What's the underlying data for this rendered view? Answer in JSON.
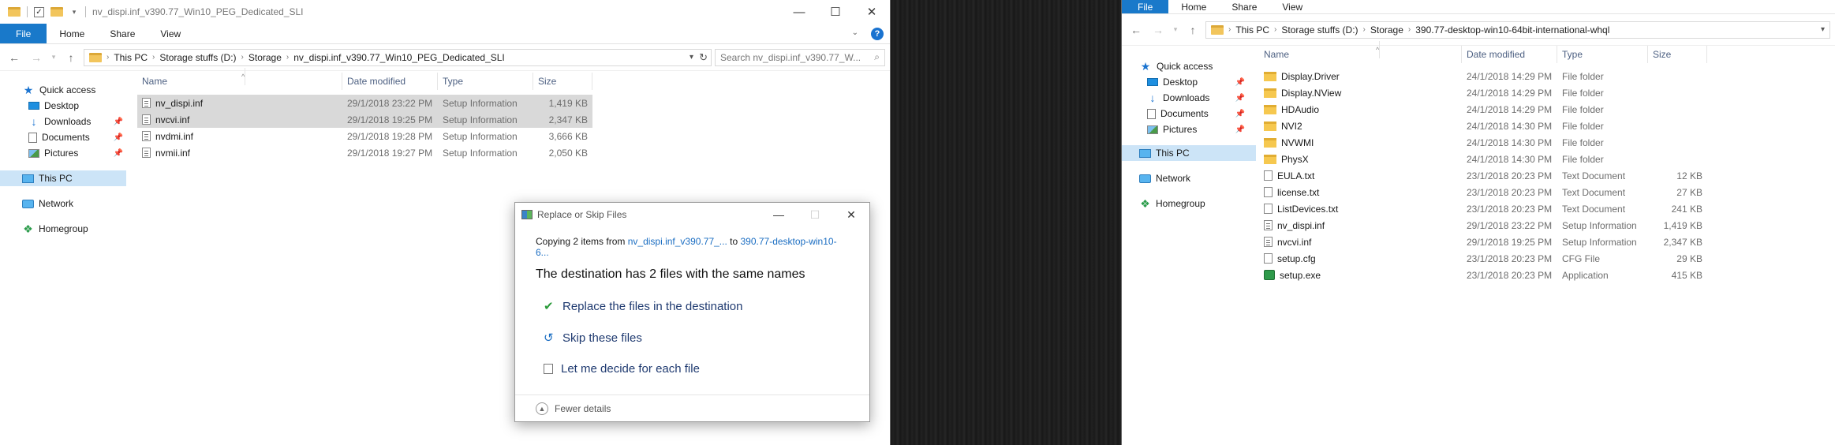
{
  "left_window": {
    "title": "nv_dispi.inf_v390.77_Win10_PEG_Dedicated_SLI",
    "ribbon_tabs": [
      "File",
      "Home",
      "Share",
      "View"
    ],
    "breadcrumbs": [
      "This PC",
      "Storage stuffs (D:)",
      "Storage",
      "nv_dispi.inf_v390.77_Win10_PEG_Dedicated_SLI"
    ],
    "search_placeholder": "Search nv_dispi.inf_v390.77_W...",
    "nav": {
      "quick_access": "Quick access",
      "items": [
        "Desktop",
        "Downloads",
        "Documents",
        "Pictures"
      ],
      "this_pc": "This PC",
      "network": "Network",
      "homegroup": "Homegroup"
    },
    "columns": [
      "Name",
      "Date modified",
      "Type",
      "Size"
    ],
    "files": [
      {
        "name": "nv_dispi.inf",
        "date": "29/1/2018 23:22 PM",
        "type": "Setup Information",
        "size": "1,419 KB"
      },
      {
        "name": "nvcvi.inf",
        "date": "29/1/2018 19:25 PM",
        "type": "Setup Information",
        "size": "2,347 KB"
      },
      {
        "name": "nvdmi.inf",
        "date": "29/1/2018 19:28 PM",
        "type": "Setup Information",
        "size": "3,666 KB"
      },
      {
        "name": "nvmii.inf",
        "date": "29/1/2018 19:27 PM",
        "type": "Setup Information",
        "size": "2,050 KB"
      }
    ]
  },
  "dialog": {
    "title": "Replace or Skip Files",
    "copying_prefix": "Copying 2 items from ",
    "from_link": "nv_dispi.inf_v390.77_...",
    "to_word": " to ",
    "to_link": "390.77-desktop-win10-6...",
    "destination_text": "The destination has 2 files with the same names",
    "option_replace": "Replace the files in the destination",
    "option_skip": "Skip these files",
    "option_decide": "Let me decide for each file",
    "fewer_details": "Fewer details"
  },
  "right_window": {
    "ribbon_tabs": [
      "File",
      "Home",
      "Share",
      "View"
    ],
    "breadcrumbs": [
      "This PC",
      "Storage stuffs (D:)",
      "Storage",
      "390.77-desktop-win10-64bit-international-whql"
    ],
    "nav": {
      "quick_access": "Quick access",
      "items": [
        "Desktop",
        "Downloads",
        "Documents",
        "Pictures"
      ],
      "this_pc": "This PC",
      "network": "Network",
      "homegroup": "Homegroup"
    },
    "columns": [
      "Name",
      "Date modified",
      "Type",
      "Size"
    ],
    "files": [
      {
        "name": "Display.Driver",
        "date": "24/1/2018 14:29 PM",
        "type": "File folder",
        "size": "",
        "kind": "folder"
      },
      {
        "name": "Display.NView",
        "date": "24/1/2018 14:29 PM",
        "type": "File folder",
        "size": "",
        "kind": "folder"
      },
      {
        "name": "HDAudio",
        "date": "24/1/2018 14:29 PM",
        "type": "File folder",
        "size": "",
        "kind": "folder"
      },
      {
        "name": "NVI2",
        "date": "24/1/2018 14:30 PM",
        "type": "File folder",
        "size": "",
        "kind": "folder"
      },
      {
        "name": "NVWMI",
        "date": "24/1/2018 14:30 PM",
        "type": "File folder",
        "size": "",
        "kind": "folder"
      },
      {
        "name": "PhysX",
        "date": "24/1/2018 14:30 PM",
        "type": "File folder",
        "size": "",
        "kind": "folder"
      },
      {
        "name": "EULA.txt",
        "date": "23/1/2018 20:23 PM",
        "type": "Text Document",
        "size": "12 KB",
        "kind": "txt"
      },
      {
        "name": "license.txt",
        "date": "23/1/2018 20:23 PM",
        "type": "Text Document",
        "size": "27 KB",
        "kind": "txt"
      },
      {
        "name": "ListDevices.txt",
        "date": "23/1/2018 20:23 PM",
        "type": "Text Document",
        "size": "241 KB",
        "kind": "txt"
      },
      {
        "name": "nv_dispi.inf",
        "date": "29/1/2018 23:22 PM",
        "type": "Setup Information",
        "size": "1,419 KB",
        "kind": "inf"
      },
      {
        "name": "nvcvi.inf",
        "date": "29/1/2018 19:25 PM",
        "type": "Setup Information",
        "size": "2,347 KB",
        "kind": "inf"
      },
      {
        "name": "setup.cfg",
        "date": "23/1/2018 20:23 PM",
        "type": "CFG File",
        "size": "29 KB",
        "kind": "txt"
      },
      {
        "name": "setup.exe",
        "date": "23/1/2018 20:23 PM",
        "type": "Application",
        "size": "415 KB",
        "kind": "exe"
      }
    ]
  }
}
